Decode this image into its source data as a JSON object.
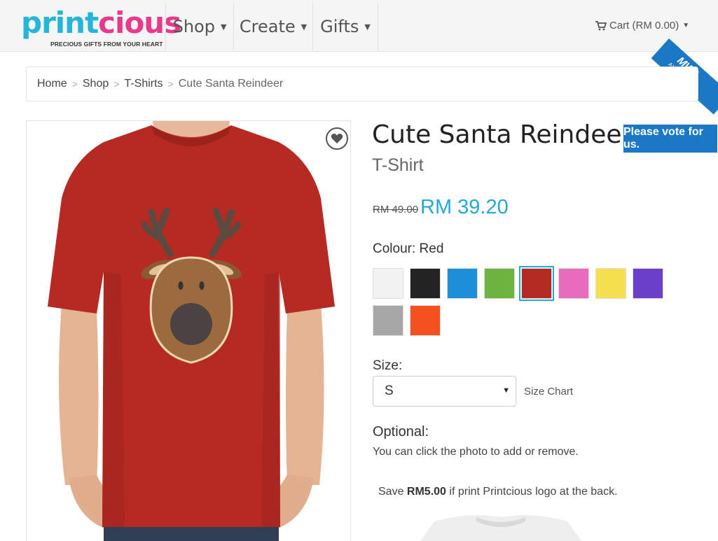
{
  "brand": {
    "name_part1": "print",
    "name_part2": "cious",
    "tagline": "PRECIOUS GIFTS FROM YOUR HEART"
  },
  "nav": {
    "items": [
      {
        "label": "Shop"
      },
      {
        "label": "Create"
      },
      {
        "label": "Gifts"
      }
    ],
    "cart_label": "Cart (RM 0.00)"
  },
  "award": {
    "mark": "MWA",
    "label": "AWARDS"
  },
  "breadcrumb": {
    "items": [
      "Home",
      "Shop",
      "T-Shirts"
    ],
    "current": "Cute Santa Reindeer"
  },
  "product": {
    "title": "Cute Santa Reindeer",
    "type": "T-Shirt",
    "price_old": "RM 49.00",
    "price_new": "RM 39.20",
    "colour_label": "Colour: Red",
    "colours": [
      "#f2f2f2",
      "#222222",
      "#1d8fd6",
      "#6db33f",
      "#b22a22",
      "#e86bbd",
      "#f7e04d",
      "#6a3fc9",
      "#a6a6a6",
      "#f4511e"
    ],
    "selected_colour_index": 4,
    "shirt_colour": "#b52a23",
    "size_label": "Size:",
    "size_value": "S",
    "size_chart_label": "Size Chart",
    "optional_label": "Optional:",
    "optional_text": "You can click the photo to add or remove.",
    "save_prefix": "Save ",
    "save_amount": "RM5.00",
    "save_suffix": " if print Printcious logo at the back."
  },
  "vote_label": "Please vote for us."
}
